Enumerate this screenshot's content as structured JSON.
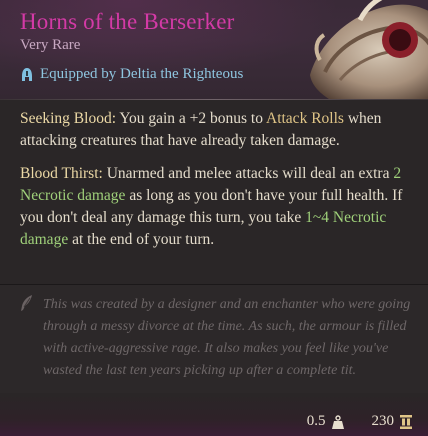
{
  "item": {
    "name": "Horns of the Berserker",
    "rarity": "Very Rare",
    "equipped": "Equipped by Deltia the Righteous"
  },
  "passives": [
    {
      "name": "Seeking Blood:",
      "text_1": " You gain a +2 bonus to ",
      "hl_1": "Attack Rolls",
      "text_2": " when attacking creatures that have already taken damage."
    },
    {
      "name": "Blood Thirst:",
      "text_1": " Unarmed and melee attacks will deal an extra ",
      "hl_1": "2 Necrotic damage",
      "text_2": " as long as you don't have your full health. If you don't deal any damage this turn, you take ",
      "hl_2": "1~4 Necrotic damage",
      "text_3": " at the end of your turn."
    }
  ],
  "flavor": "This was created by a designer and an enchanter who were going through a messy divorce at the time. As such, the armour is filled with active-aggressive rage. It also makes you feel like you've wasted the last ten years picking up after a complete tit.",
  "footer": {
    "weight": "0.5",
    "value": "230"
  },
  "colors": {
    "title": "#d33aa6",
    "equipped": "#8fc6e0",
    "highlight_gold": "#e0c587",
    "highlight_green": "#9fd07a"
  },
  "icons": {
    "equipped": "helmet-icon",
    "flavor": "quill-icon",
    "weight": "weight-icon",
    "value": "gold-coins-icon"
  }
}
